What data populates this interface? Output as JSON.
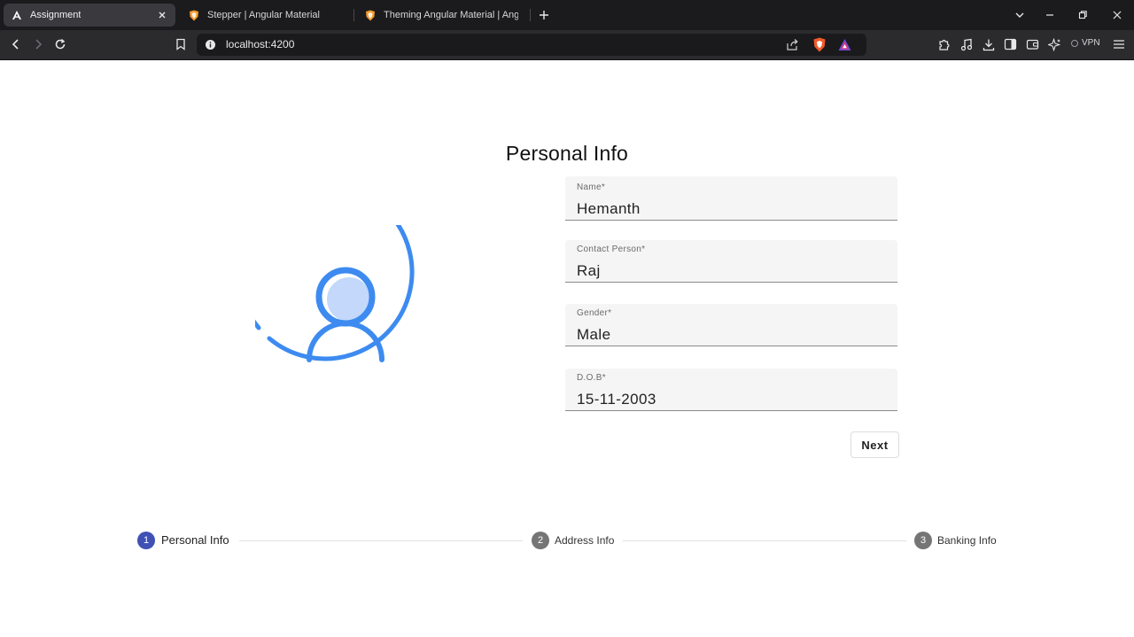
{
  "browser": {
    "tabs": [
      {
        "title": "Assignment",
        "active": true
      },
      {
        "title": "Stepper | Angular Material",
        "active": false
      },
      {
        "title": "Theming Angular Material | Angular",
        "active": false
      }
    ],
    "url": "localhost:4200",
    "vpn_label": "VPN"
  },
  "page": {
    "title": "Personal Info",
    "fields": [
      {
        "label": "Name*",
        "value": "Hemanth"
      },
      {
        "label": "Contact Person*",
        "value": "Raj"
      },
      {
        "label": "Gender*",
        "value": "Male"
      },
      {
        "label": "D.O.B*",
        "value": "15-11-2003"
      }
    ],
    "next_label": "Next"
  },
  "stepper": {
    "steps": [
      {
        "number": "1",
        "label": "Personal Info",
        "active": true
      },
      {
        "number": "2",
        "label": "Address Info",
        "active": false
      },
      {
        "number": "3",
        "label": "Banking Info",
        "active": false
      }
    ]
  },
  "colors": {
    "accent": "#3f51b5",
    "inactive_step": "#757575",
    "avatar_blue": "#3d8bf0",
    "avatar_fill": "#c3d8fb"
  }
}
